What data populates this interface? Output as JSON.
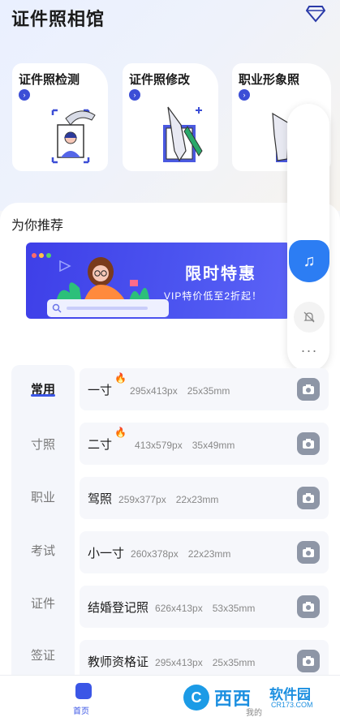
{
  "app": {
    "title": "证件照相馆"
  },
  "features": [
    {
      "label": "证件照检测",
      "icon": "face-check-illustration"
    },
    {
      "label": "证件照修改",
      "icon": "pen-edit-illustration"
    },
    {
      "label": "职业形象照",
      "icon": "professional-photo-illustration"
    }
  ],
  "recommend": {
    "title": "为你推荐"
  },
  "banner": {
    "title": "限时特惠",
    "subtitle": "VIP特价低至2折起！"
  },
  "categories": [
    {
      "label": "常用",
      "active": true
    },
    {
      "label": "寸照",
      "active": false
    },
    {
      "label": "职业",
      "active": false
    },
    {
      "label": "考试",
      "active": false
    },
    {
      "label": "证件",
      "active": false
    },
    {
      "label": "签证",
      "active": false
    }
  ],
  "sizes": [
    {
      "name": "一寸",
      "px": "295x413px",
      "mm": "25x35mm",
      "hot": true
    },
    {
      "name": "二寸",
      "px": "413x579px",
      "mm": "35x49mm",
      "hot": true
    },
    {
      "name": "驾照",
      "px": "259x377px",
      "mm": "22x23mm",
      "hot": false
    },
    {
      "name": "小一寸",
      "px": "260x378px",
      "mm": "22x23mm",
      "hot": false
    },
    {
      "name": "结婚登记照",
      "px": "626x413px",
      "mm": "53x35mm",
      "hot": false
    },
    {
      "name": "教师资格证",
      "px": "295x413px",
      "mm": "25x35mm",
      "hot": false
    }
  ],
  "float_controls": {
    "music": "music-icon",
    "mute": "bell-off-icon",
    "more": "···"
  },
  "nav": {
    "home": "首页",
    "mine": "我的"
  },
  "watermark": {
    "logo": "C",
    "brand": "西西",
    "name": "软件园",
    "url": "CR173.COM"
  },
  "colors": {
    "accent": "#3b56e6",
    "banner": "#4347ec",
    "float_active": "#2c7df3"
  }
}
